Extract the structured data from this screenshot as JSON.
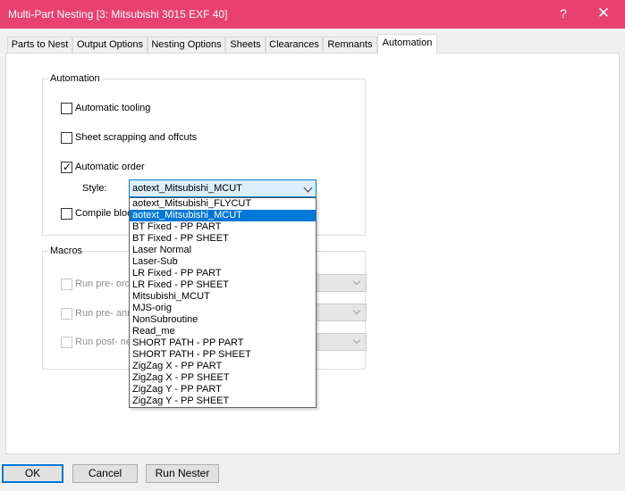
{
  "window": {
    "title": "Multi-Part Nesting [3: Mitsubishi 3015 EXF 40]",
    "help": "?",
    "close": "✕"
  },
  "tabs": [
    {
      "label": "Parts to Nest"
    },
    {
      "label": "Output Options"
    },
    {
      "label": "Nesting Options"
    },
    {
      "label": "Sheets"
    },
    {
      "label": "Clearances"
    },
    {
      "label": "Remnants"
    },
    {
      "label": "Automation"
    }
  ],
  "automation": {
    "group_label": "Automation",
    "automatic_tooling": "Automatic tooling",
    "sheet_scrapping": "Sheet scrapping and offcuts",
    "automatic_order": "Automatic order",
    "style_label": "Style:",
    "style_value": "aotext_Mitsubishi_MCUT",
    "compile_block": "Compile bloc"
  },
  "macros": {
    "group_label": "Macros",
    "run_pre_order": "Run pre- orde",
    "run_pre_ann": "Run pre- ann",
    "run_post_ne": "Run post- ne"
  },
  "style_options": [
    "aotext_Mitsubishi_FLYCUT",
    "aotext_Mitsubishi_MCUT",
    "BT Fixed - PP PART",
    "BT Fixed - PP SHEET",
    "Laser Normal",
    "Laser-Sub",
    "LR Fixed - PP PART",
    "LR Fixed - PP SHEET",
    "Mitsubishi_MCUT",
    "MJS-orig",
    "NonSubroutine",
    "Read_me",
    "SHORT PATH - PP PART",
    "SHORT PATH - PP SHEET",
    "ZigZag X - PP PART",
    "ZigZag X - PP SHEET",
    "ZigZag Y - PP PART",
    "ZigZag Y - PP SHEET"
  ],
  "buttons": {
    "ok": "OK",
    "cancel": "Cancel",
    "run_nester": "Run Nester"
  },
  "check_mark": "✓",
  "colors": {
    "titlebar": "#e8416f",
    "selection": "#0078d7"
  }
}
